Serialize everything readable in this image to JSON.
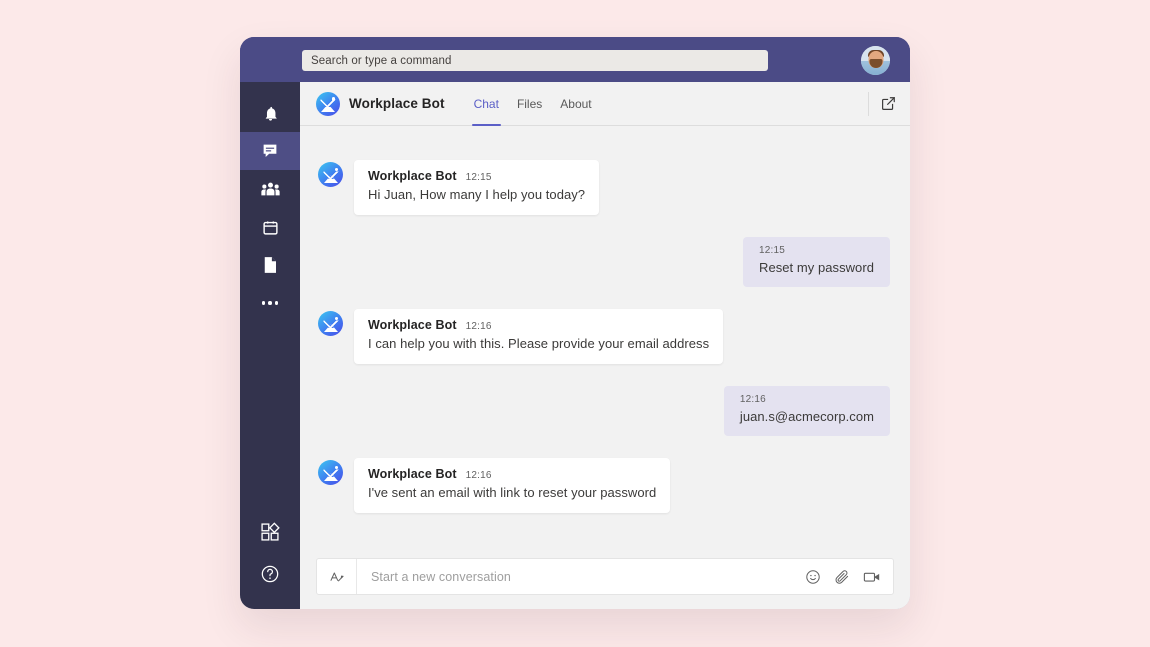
{
  "theme": {
    "page_bg": "#fce9e9",
    "titlebar_bg": "#4b4b86",
    "rail_bg": "#33334d",
    "rail_active_bg": "#4e4e85",
    "chat_bg": "#f2f2f2",
    "accent": "#5b5fc7",
    "user_bubble_bg": "#e4e2f0",
    "bot_bubble_bg": "#ffffff"
  },
  "titlebar": {
    "search_placeholder": "Search or type a command",
    "avatar_label": "user-avatar"
  },
  "rail": {
    "items": [
      {
        "id": "activity",
        "icon": "bell-icon",
        "label": "Activity",
        "active": false
      },
      {
        "id": "chat",
        "icon": "chat-icon",
        "label": "Chat",
        "active": true
      },
      {
        "id": "teams",
        "icon": "people-icon",
        "label": "Teams",
        "active": false
      },
      {
        "id": "calendar",
        "icon": "calendar-icon",
        "label": "Calendar",
        "active": false
      },
      {
        "id": "files",
        "icon": "files-icon",
        "label": "Files",
        "active": false
      },
      {
        "id": "more",
        "icon": "more-icon",
        "label": "More",
        "active": false
      }
    ],
    "bottom_items": [
      {
        "id": "apps",
        "icon": "apps-icon",
        "label": "Apps"
      },
      {
        "id": "help",
        "icon": "help-icon",
        "label": "Help"
      }
    ]
  },
  "app_header": {
    "title": "Workplace Bot",
    "avatar_label": "bot-avatar",
    "tabs": [
      {
        "label": "Chat",
        "active": true
      },
      {
        "label": "Files",
        "active": false
      },
      {
        "label": "About",
        "active": false
      }
    ],
    "popout_icon": "popout-icon"
  },
  "chat": {
    "messages": [
      {
        "from": "bot",
        "sender": "Workplace Bot",
        "time": "12:15",
        "text": "Hi Juan, How many I help you today?"
      },
      {
        "from": "user",
        "sender": "",
        "time": "12:15",
        "text": "Reset my password"
      },
      {
        "from": "bot",
        "sender": "Workplace Bot",
        "time": "12:16",
        "text": "I can help you with this. Please provide your email address"
      },
      {
        "from": "user",
        "sender": "",
        "time": "12:16",
        "text": "juan.s@acmecorp.com"
      },
      {
        "from": "bot",
        "sender": "Workplace Bot",
        "time": "12:16",
        "text": "I've sent an email with link to reset your password"
      }
    ]
  },
  "compose": {
    "placeholder": "Start a new conversation",
    "format_icon": "format-text-icon",
    "actions": [
      {
        "id": "emoji",
        "icon": "emoji-icon"
      },
      {
        "id": "attach",
        "icon": "paperclip-icon"
      },
      {
        "id": "meet",
        "icon": "video-icon"
      }
    ]
  }
}
